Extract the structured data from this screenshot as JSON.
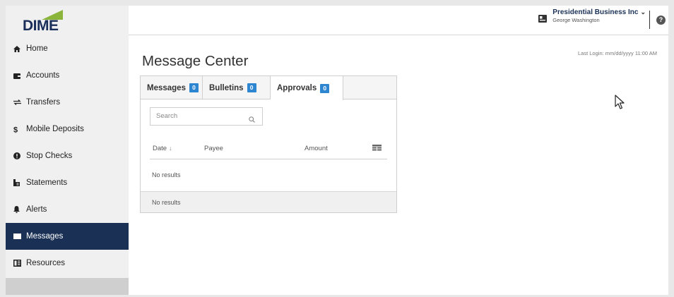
{
  "brand": {
    "logo_text": "DIME"
  },
  "sidebar": {
    "items": [
      {
        "label": "Home",
        "icon": "home-icon"
      },
      {
        "label": "Accounts",
        "icon": "wallet-icon"
      },
      {
        "label": "Transfers",
        "icon": "transfer-icon"
      },
      {
        "label": "Mobile Deposits",
        "icon": "dollar-icon"
      },
      {
        "label": "Stop Checks",
        "icon": "alert-circle-icon"
      },
      {
        "label": "Statements",
        "icon": "statement-icon"
      },
      {
        "label": "Alerts",
        "icon": "bell-icon"
      },
      {
        "label": "Messages",
        "icon": "envelope-icon",
        "active": true
      },
      {
        "label": "Resources",
        "icon": "book-icon"
      }
    ]
  },
  "header": {
    "account_name": "Presidential Business Inc",
    "caret": "⌄",
    "user_name": "George Washington",
    "help_glyph": "?"
  },
  "main": {
    "title": "Message Center",
    "last_login": "Last Login: mm/dd/yyyy  11:00 AM",
    "tabs": [
      {
        "label": "Messages",
        "count": "0"
      },
      {
        "label": "Bulletins",
        "count": "0"
      },
      {
        "label": "Approvals",
        "count": "0",
        "active": true
      }
    ],
    "search": {
      "placeholder": "Search"
    },
    "table": {
      "columns": [
        "Date",
        "Payee",
        "Amount"
      ],
      "sort_indicator": "↓",
      "empty_text": "No results"
    },
    "footer_empty_text": "No results"
  },
  "colors": {
    "brand_navy": "#1a3155",
    "brand_green": "#8ab43a",
    "badge_blue": "#2f86d0"
  }
}
